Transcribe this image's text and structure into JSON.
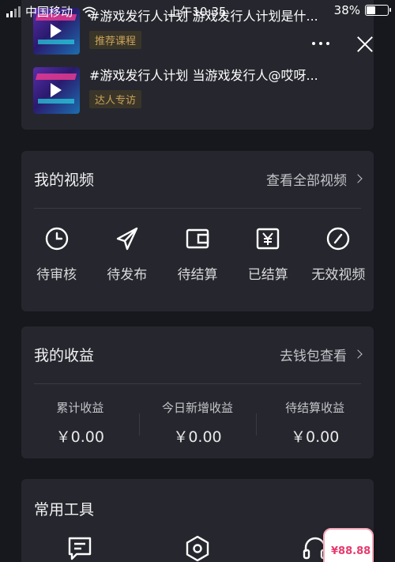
{
  "status_bar": {
    "carrier": "中国移动",
    "time": "上午10:35",
    "battery": "38%",
    "battery_level": 0.38
  },
  "courses": [
    {
      "title": "#游戏发行人计划 游戏发行人计划是什...",
      "tag": "推荐课程"
    },
    {
      "title": "#游戏发行人计划 当游戏发行人@哎呀...",
      "tag": "达人专访"
    }
  ],
  "my_videos": {
    "title": "我的视频",
    "link": "查看全部视频",
    "statuses": [
      {
        "label": "待审核",
        "icon": "clock-icon"
      },
      {
        "label": "待发布",
        "icon": "send-icon"
      },
      {
        "label": "待结算",
        "icon": "wallet-icon"
      },
      {
        "label": "已结算",
        "icon": "yen-icon"
      },
      {
        "label": "无效视频",
        "icon": "forbidden-icon"
      }
    ]
  },
  "my_income": {
    "title": "我的收益",
    "link": "去钱包查看",
    "items": [
      {
        "label": "累计收益",
        "value": "￥0.00"
      },
      {
        "label": "今日新增收益",
        "value": "￥0.00"
      },
      {
        "label": "待结算收益",
        "value": "￥0.00"
      }
    ]
  },
  "tools": {
    "title": "常用工具",
    "icons": [
      "message-icon",
      "settings-icon",
      "headset-icon"
    ]
  },
  "float_badge": {
    "text": "¥88.88"
  }
}
